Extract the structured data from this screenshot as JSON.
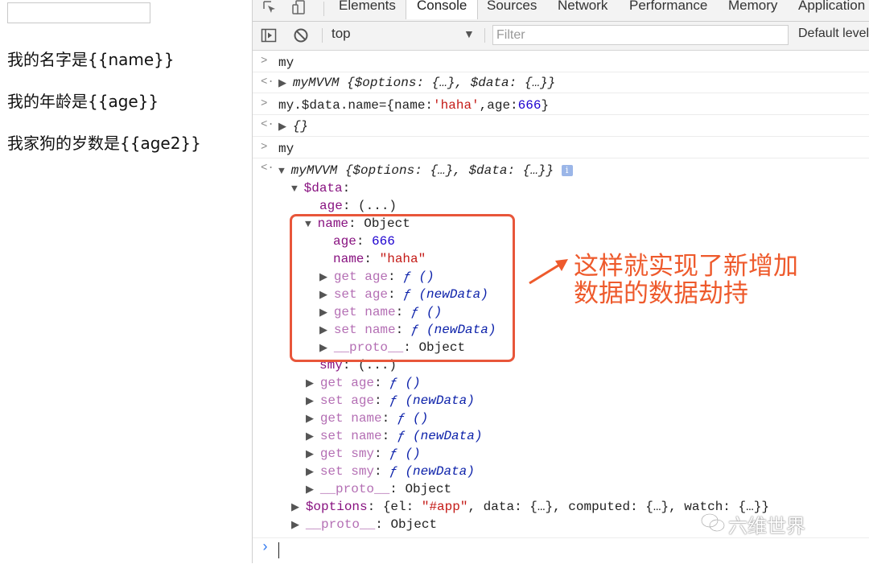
{
  "page": {
    "line1": "我的名字是{{name}}",
    "line2": "我的年龄是{{age}}",
    "line3": "我家狗的岁数是{{age2}}"
  },
  "devtools": {
    "tabs": [
      "Elements",
      "Console",
      "Sources",
      "Network",
      "Performance",
      "Memory",
      "Application"
    ],
    "active_tab": "Console",
    "context": "top",
    "filter_placeholder": "Filter",
    "levels": "Default levels"
  },
  "console": {
    "input1": "my",
    "output1_name": "myMVVM",
    "output1_rest": " {$options: {…}, $data: {…}}",
    "input2_pre": "my.$data.name={name:",
    "input2_str": "'haha'",
    "input2_mid": ",age:",
    "input2_num": "666",
    "input2_post": "}",
    "output2": "{}",
    "input3": "my",
    "output3_name": "myMVVM",
    "output3_rest": " {$options: {…}, $data: {…}}",
    "data_key": "$data",
    "age_key": "age",
    "age_val": "(...)",
    "name_key": "name",
    "name_val": "Object",
    "inner_age_key": "age",
    "inner_age_val": "666",
    "inner_name_key": "name",
    "inner_name_val": "\"haha\"",
    "get_age": "get age",
    "set_age": "set age",
    "get_name": "get name",
    "set_name": "set name",
    "proto": "__proto__",
    "object_word": "Object",
    "fn_empty": "ƒ ()",
    "fn_new": "ƒ (newData)",
    "smy_key": "smy",
    "smy_val": "(...)",
    "get_smy": "get smy",
    "set_smy": "set smy",
    "options_key": "$options",
    "options_pre": "{el: ",
    "options_str": "\"#app\"",
    "options_post": ", data: {…}, computed: {…}, watch: {…}}"
  },
  "annotation": {
    "line1": "这样就实现了新增加",
    "line2": "数据的数据劫持"
  },
  "watermark": "六维世界",
  "colors": {
    "annotation": "#ee5a2c",
    "key": "#881280",
    "number": "#1c00cf",
    "string": "#c41a16"
  }
}
